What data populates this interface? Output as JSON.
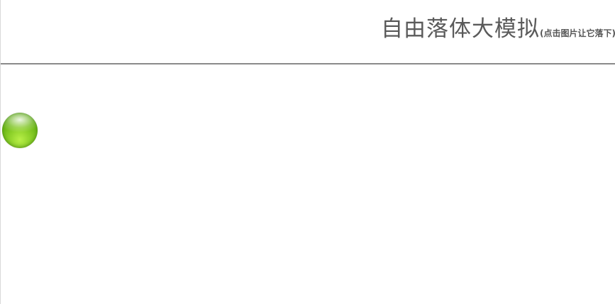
{
  "header": {
    "title": "自由落体大模拟",
    "hint": "(点击图片让它落下)"
  },
  "ball": {
    "icon": "green-ball-icon",
    "colors": {
      "light": "#b8ef47",
      "mid": "#67b314",
      "dark": "#3f8d08"
    }
  }
}
